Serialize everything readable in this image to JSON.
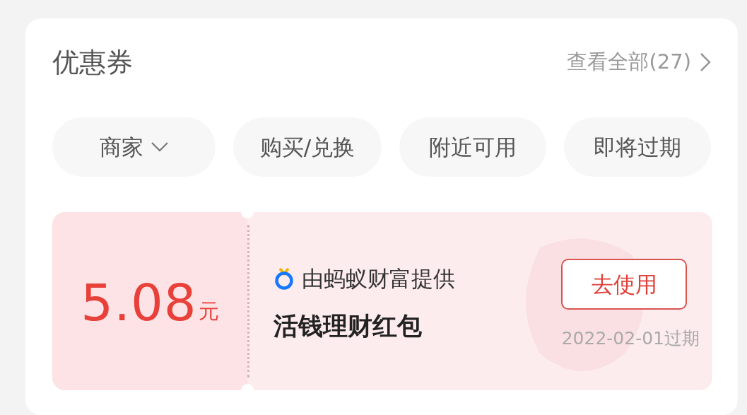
{
  "section": {
    "title": "优惠券",
    "view_all": "查看全部(27)"
  },
  "filters": [
    {
      "label": "商家",
      "kind": "dropdown"
    },
    {
      "label": "购买/兑换",
      "kind": "plain"
    },
    {
      "label": "附近可用",
      "kind": "plain"
    },
    {
      "label": "即将过期",
      "kind": "plain"
    }
  ],
  "coupons": [
    {
      "amount": "5.08",
      "unit": "元",
      "provider": "由蚂蚁财富提供",
      "name": "活钱理财红包",
      "action": "去使用",
      "expiry": "2022-02-01过期"
    }
  ]
}
